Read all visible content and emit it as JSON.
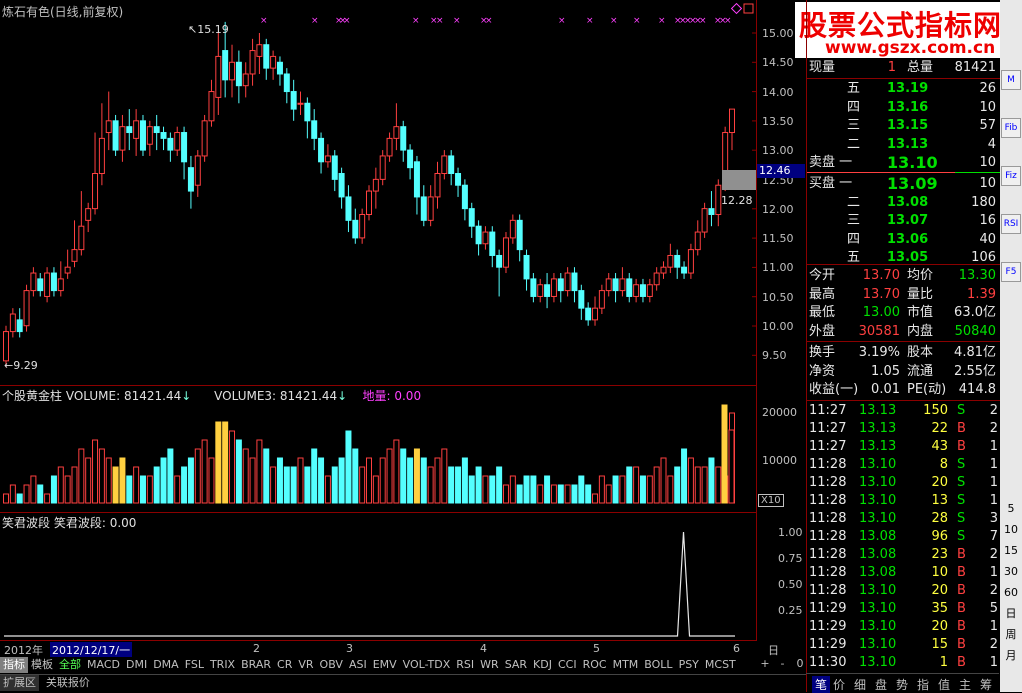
{
  "chart_title": "炼石有色(日线,前复权)",
  "price_axis": [
    "15.00",
    "14.50",
    "14.00",
    "13.50",
    "13.00",
    "12.50",
    "12.00",
    "11.50",
    "11.00",
    "10.50",
    "10.00",
    "9.50"
  ],
  "price_high_label": "15.19",
  "price_low_label": "9.29",
  "current_price_tag": "12.46",
  "price_12_28": "12.28",
  "volume_indicator": {
    "name": "个股黄金柱",
    "vol_label": "VOLUME: 81421.44",
    "vol3_label": "VOLUME3: 81421.44",
    "diliang_label": "地量: 0.00"
  },
  "volume_axis": [
    "20000",
    "10000"
  ],
  "volume_unit": "X10",
  "wave_indicator": {
    "name": "笑君波段",
    "value_label": "笑君波段: 0.00"
  },
  "wave_axis": [
    "1.00",
    "0.75",
    "0.50",
    "0.25"
  ],
  "timeline": {
    "year": "2012年",
    "date": "2012/12/17/一",
    "ticks": [
      "2",
      "3",
      "4",
      "5",
      "6"
    ],
    "period": "日线"
  },
  "tabs": [
    "指标",
    "模板",
    "全部",
    "MACD",
    "DMI",
    "DMA",
    "FSL",
    "TRIX",
    "BRAR",
    "CR",
    "VR",
    "OBV",
    "ASI",
    "EMV",
    "VOL-TDX",
    "RSI",
    "WR",
    "SAR",
    "KDJ",
    "CCI",
    "ROC",
    "MTM",
    "BOLL",
    "PSY",
    "MCST"
  ],
  "zoom_btns": [
    "+",
    "-",
    "0"
  ],
  "bottom_tabs": [
    "扩展区",
    "关联报价"
  ],
  "watermark": {
    "line1": "股票公式指标网",
    "line2": "www.gszx.com.cn"
  },
  "quote": {
    "xianliang_label": "现量",
    "xianliang": "1",
    "zongliang_label": "总量",
    "zongliang": "81421",
    "sell": [
      {
        "label": "五",
        "price": "13.19",
        "vol": "26"
      },
      {
        "label": "四",
        "price": "13.16",
        "vol": "10"
      },
      {
        "label": "三",
        "price": "13.15",
        "vol": "57"
      },
      {
        "label": "二",
        "price": "13.13",
        "vol": "4"
      },
      {
        "label": "卖盘 一",
        "price": "13.10",
        "vol": "10"
      }
    ],
    "buy": [
      {
        "label": "买盘 一",
        "price": "13.09",
        "vol": "10"
      },
      {
        "label": "二",
        "price": "13.08",
        "vol": "180"
      },
      {
        "label": "三",
        "price": "13.07",
        "vol": "16"
      },
      {
        "label": "四",
        "price": "13.06",
        "vol": "40"
      },
      {
        "label": "五",
        "price": "13.05",
        "vol": "106"
      }
    ],
    "stats": [
      {
        "l1": "今开",
        "v1": "13.70",
        "c1": "red",
        "l2": "均价",
        "v2": "13.30",
        "c2": "green"
      },
      {
        "l1": "最高",
        "v1": "13.70",
        "c1": "red",
        "l2": "量比",
        "v2": "1.39",
        "c2": "red"
      },
      {
        "l1": "最低",
        "v1": "13.00",
        "c1": "green",
        "l2": "市值",
        "v2": "63.0亿",
        "c2": "white"
      },
      {
        "l1": "外盘",
        "v1": "30581",
        "c1": "red",
        "l2": "内盘",
        "v2": "50840",
        "c2": "green"
      }
    ],
    "stats2": [
      {
        "l1": "换手",
        "v1": "3.19%",
        "l2": "股本",
        "v2": "4.81亿"
      },
      {
        "l1": "净资",
        "v1": "1.05",
        "l2": "流通",
        "v2": "2.55亿"
      },
      {
        "l1": "收益(一)",
        "v1": "0.01",
        "l2": "PE(动)",
        "v2": "414.8"
      }
    ],
    "ticks": [
      {
        "t": "11:27",
        "p": "13.13",
        "v": "150",
        "bs": "S",
        "n": "2"
      },
      {
        "t": "11:27",
        "p": "13.13",
        "v": "22",
        "bs": "B",
        "n": "2"
      },
      {
        "t": "11:27",
        "p": "13.13",
        "v": "43",
        "bs": "B",
        "n": "1"
      },
      {
        "t": "11:28",
        "p": "13.10",
        "v": "8",
        "bs": "S",
        "n": "1"
      },
      {
        "t": "11:28",
        "p": "13.10",
        "v": "20",
        "bs": "S",
        "n": "1"
      },
      {
        "t": "11:28",
        "p": "13.10",
        "v": "13",
        "bs": "S",
        "n": "1"
      },
      {
        "t": "11:28",
        "p": "13.10",
        "v": "28",
        "bs": "S",
        "n": "3"
      },
      {
        "t": "11:28",
        "p": "13.08",
        "v": "96",
        "bs": "S",
        "n": "7"
      },
      {
        "t": "11:28",
        "p": "13.08",
        "v": "23",
        "bs": "B",
        "n": "2"
      },
      {
        "t": "11:28",
        "p": "13.08",
        "v": "10",
        "bs": "B",
        "n": "1"
      },
      {
        "t": "11:28",
        "p": "13.10",
        "v": "20",
        "bs": "B",
        "n": "2"
      },
      {
        "t": "11:29",
        "p": "13.10",
        "v": "35",
        "bs": "B",
        "n": "5"
      },
      {
        "t": "11:29",
        "p": "13.10",
        "v": "20",
        "bs": "B",
        "n": "1"
      },
      {
        "t": "11:29",
        "p": "13.10",
        "v": "15",
        "bs": "B",
        "n": "2"
      },
      {
        "t": "11:30",
        "p": "13.10",
        "v": "1",
        "bs": "B",
        "n": "1"
      }
    ],
    "right_tabs": [
      "笔",
      "价",
      "细",
      "盘",
      "势",
      "指",
      "值",
      "主",
      "筹"
    ]
  },
  "sidebar": [
    "M",
    "Fib",
    "Fiz",
    "RSI",
    "F5",
    "5",
    "10",
    "15",
    "30",
    "60",
    "日",
    "周",
    "月"
  ],
  "chart_data": {
    "type": "candlestick",
    "title": "炼石有色(日线,前复权)",
    "ylim": [
      9.3,
      15.2
    ],
    "candles": [
      [
        9.4,
        9.9,
        9.29,
        10.0
      ],
      [
        9.9,
        10.2,
        9.8,
        10.3
      ],
      [
        10.1,
        9.9,
        9.8,
        10.3
      ],
      [
        10.0,
        10.6,
        9.9,
        10.7
      ],
      [
        10.6,
        10.9,
        10.5,
        11.0
      ],
      [
        10.8,
        10.6,
        10.5,
        10.9
      ],
      [
        10.5,
        10.9,
        10.4,
        11.0
      ],
      [
        10.9,
        10.6,
        10.5,
        11.0
      ],
      [
        10.6,
        10.8,
        10.5,
        11.1
      ],
      [
        10.9,
        11.0,
        10.8,
        11.3
      ],
      [
        11.1,
        11.3,
        11.0,
        11.8
      ],
      [
        11.3,
        11.7,
        11.2,
        12.3
      ],
      [
        11.8,
        12.0,
        11.6,
        12.1
      ],
      [
        12.0,
        12.6,
        11.9,
        13.3
      ],
      [
        12.6,
        13.2,
        12.4,
        13.8
      ],
      [
        13.3,
        13.5,
        13.0,
        14.0
      ],
      [
        13.5,
        13.0,
        12.9,
        13.6
      ],
      [
        13.0,
        13.4,
        12.8,
        13.6
      ],
      [
        13.4,
        13.3,
        13.0,
        13.7
      ],
      [
        13.2,
        13.5,
        12.9,
        13.7
      ],
      [
        13.5,
        13.0,
        12.9,
        13.6
      ],
      [
        13.1,
        13.4,
        12.9,
        13.5
      ],
      [
        13.4,
        13.3,
        13.0,
        13.6
      ],
      [
        13.3,
        13.2,
        13.0,
        13.4
      ],
      [
        13.2,
        13.0,
        12.8,
        13.3
      ],
      [
        13.0,
        13.3,
        12.9,
        13.4
      ],
      [
        13.3,
        12.8,
        12.5,
        13.4
      ],
      [
        12.7,
        12.3,
        12.0,
        12.9
      ],
      [
        12.4,
        12.9,
        12.2,
        13.0
      ],
      [
        12.9,
        13.5,
        12.8,
        13.6
      ],
      [
        13.5,
        14.0,
        13.4,
        14.2
      ],
      [
        13.9,
        14.6,
        13.6,
        15.0
      ],
      [
        14.7,
        14.2,
        13.9,
        15.19
      ],
      [
        14.2,
        14.5,
        13.9,
        14.8
      ],
      [
        14.5,
        14.1,
        13.8,
        14.7
      ],
      [
        14.1,
        14.3,
        13.9,
        14.5
      ],
      [
        14.3,
        14.7,
        14.1,
        14.9
      ],
      [
        14.6,
        14.8,
        14.3,
        15.0
      ],
      [
        14.8,
        14.4,
        14.2,
        14.9
      ],
      [
        14.4,
        14.6,
        14.2,
        14.7
      ],
      [
        14.5,
        14.3,
        14.1,
        14.6
      ],
      [
        14.3,
        14.0,
        13.8,
        14.4
      ],
      [
        14.0,
        13.7,
        13.5,
        14.2
      ],
      [
        13.8,
        13.8,
        13.6,
        14.0
      ],
      [
        13.8,
        13.5,
        13.2,
        13.9
      ],
      [
        13.5,
        13.2,
        13.0,
        13.7
      ],
      [
        13.2,
        12.8,
        12.6,
        13.3
      ],
      [
        12.8,
        12.9,
        12.7,
        13.1
      ],
      [
        12.9,
        12.5,
        12.3,
        13.0
      ],
      [
        12.6,
        12.2,
        12.0,
        12.7
      ],
      [
        12.2,
        11.8,
        11.6,
        12.4
      ],
      [
        11.8,
        11.5,
        11.4,
        12.0
      ],
      [
        11.5,
        11.9,
        11.4,
        12.0
      ],
      [
        11.9,
        12.3,
        11.8,
        12.4
      ],
      [
        12.3,
        12.5,
        12.0,
        12.7
      ],
      [
        12.5,
        12.9,
        12.4,
        13.0
      ],
      [
        12.9,
        13.2,
        12.8,
        13.3
      ],
      [
        13.2,
        13.4,
        13.0,
        13.8
      ],
      [
        13.4,
        13.0,
        12.8,
        13.5
      ],
      [
        13.0,
        12.7,
        12.5,
        13.1
      ],
      [
        12.8,
        12.2,
        11.9,
        12.9
      ],
      [
        12.2,
        11.8,
        11.7,
        12.4
      ],
      [
        11.8,
        12.2,
        11.7,
        12.4
      ],
      [
        12.2,
        12.6,
        12.0,
        12.8
      ],
      [
        12.6,
        12.9,
        12.5,
        13.0
      ],
      [
        12.9,
        12.6,
        12.4,
        13.0
      ],
      [
        12.6,
        12.4,
        12.2,
        12.7
      ],
      [
        12.4,
        12.0,
        11.8,
        12.5
      ],
      [
        12.0,
        11.7,
        11.5,
        12.1
      ],
      [
        11.7,
        11.4,
        11.2,
        11.8
      ],
      [
        11.4,
        11.6,
        11.3,
        11.7
      ],
      [
        11.6,
        11.2,
        11.0,
        11.7
      ],
      [
        11.2,
        11.0,
        10.5,
        11.3
      ],
      [
        11.0,
        11.5,
        10.9,
        11.6
      ],
      [
        11.5,
        11.8,
        11.4,
        11.9
      ],
      [
        11.8,
        11.3,
        11.1,
        11.9
      ],
      [
        11.2,
        10.8,
        10.6,
        11.3
      ],
      [
        10.8,
        10.5,
        10.4,
        10.9
      ],
      [
        10.5,
        10.7,
        10.4,
        10.8
      ],
      [
        10.7,
        10.5,
        10.3,
        10.9
      ],
      [
        10.5,
        10.8,
        10.4,
        10.9
      ],
      [
        10.8,
        10.6,
        10.4,
        10.9
      ],
      [
        10.6,
        10.9,
        10.5,
        11.0
      ],
      [
        10.9,
        10.6,
        10.4,
        11.0
      ],
      [
        10.6,
        10.3,
        10.1,
        10.7
      ],
      [
        10.3,
        10.1,
        10.0,
        10.4
      ],
      [
        10.1,
        10.3,
        10.0,
        10.5
      ],
      [
        10.3,
        10.6,
        10.2,
        10.7
      ],
      [
        10.6,
        10.8,
        10.5,
        10.9
      ],
      [
        10.8,
        10.6,
        10.4,
        10.9
      ],
      [
        10.6,
        10.8,
        10.5,
        11.0
      ],
      [
        10.8,
        10.5,
        10.4,
        10.9
      ],
      [
        10.5,
        10.7,
        10.4,
        10.8
      ],
      [
        10.7,
        10.5,
        10.4,
        10.8
      ],
      [
        10.5,
        10.7,
        10.4,
        10.8
      ],
      [
        10.7,
        10.9,
        10.6,
        11.0
      ],
      [
        10.9,
        11.0,
        10.8,
        11.1
      ],
      [
        11.0,
        11.2,
        10.9,
        11.4
      ],
      [
        11.2,
        11.0,
        10.8,
        11.3
      ],
      [
        11.0,
        10.9,
        10.8,
        11.1
      ],
      [
        10.9,
        11.3,
        10.8,
        11.4
      ],
      [
        11.3,
        11.6,
        11.2,
        11.8
      ],
      [
        11.6,
        12.0,
        11.5,
        12.1
      ],
      [
        12.0,
        11.9,
        11.7,
        12.3
      ],
      [
        11.9,
        12.4,
        11.7,
        12.5
      ],
      [
        12.5,
        13.3,
        12.3,
        13.4
      ],
      [
        13.3,
        13.7,
        13.0,
        13.7
      ]
    ],
    "wave": {
      "peak_index": 96,
      "peak_value": 1.0
    }
  }
}
